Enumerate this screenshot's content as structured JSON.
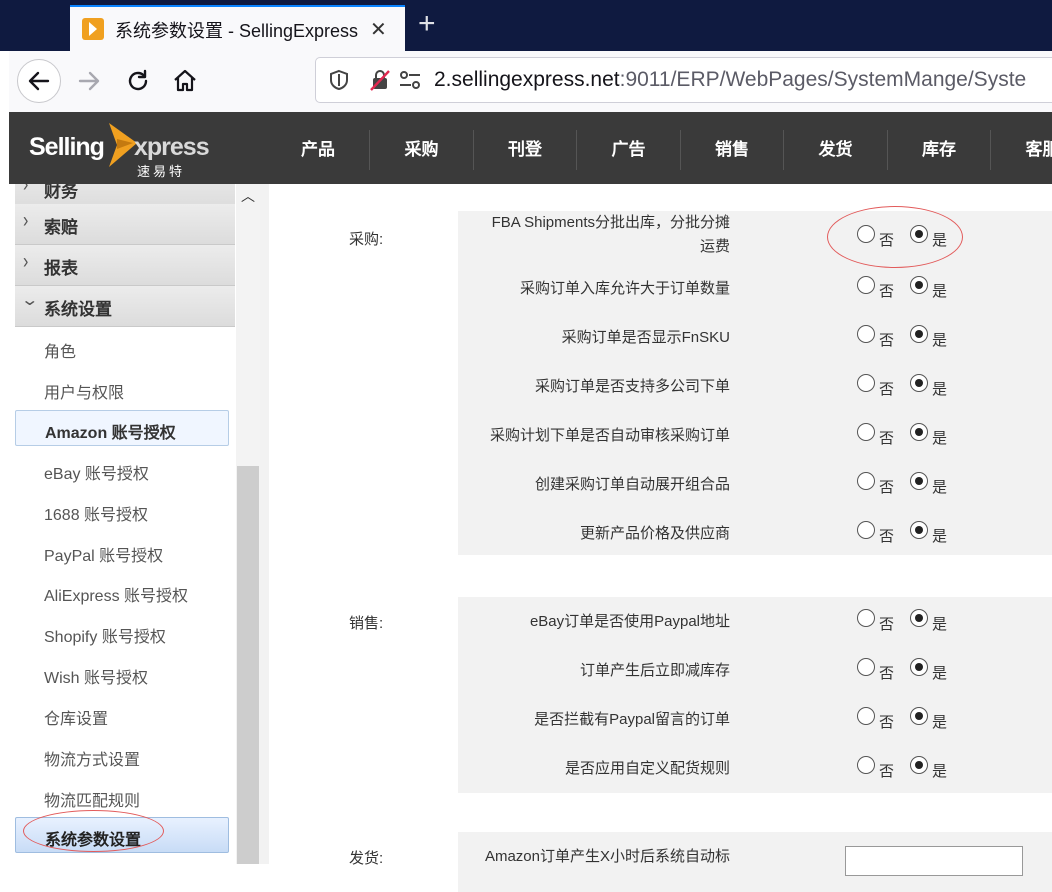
{
  "browser": {
    "tab_title": "系统参数设置 - SellingExpress",
    "close_glyph": "✕",
    "new_tab_glyph": "+",
    "url_host": "2.sellingexpress.net",
    "url_rest": ":9011/ERP/WebPages/SystemMange/Syste"
  },
  "app": {
    "logo_word1": "Selling",
    "logo_word2": "xpress",
    "logo_sub": "速易特",
    "menu": [
      "产品",
      "采购",
      "刊登",
      "广告",
      "销售",
      "发货",
      "库存",
      "客服"
    ]
  },
  "sidebar": {
    "groups": [
      {
        "label": "财务",
        "chevron": "›"
      },
      {
        "label": "索赔",
        "chevron": "›"
      },
      {
        "label": "报表",
        "chevron": "›"
      },
      {
        "label": "系统设置",
        "chevron": "⌄"
      }
    ],
    "items": [
      "角色",
      "用户与权限",
      "Amazon 账号授权",
      "eBay 账号授权",
      "1688 账号授权",
      "PayPal 账号授权",
      "AliExpress 账号授权",
      "Shopify 账号授权",
      "Wish 账号授权",
      "仓库设置",
      "物流方式设置",
      "物流匹配规则",
      "系统参数设置"
    ],
    "active_item": "Amazon 账号授权",
    "current_item": "系统参数设置"
  },
  "radio_labels": {
    "no": "否",
    "yes": "是"
  },
  "sections": [
    {
      "label": "采购:",
      "rows": [
        {
          "line1": "FBA Shipments分批出库，分批分摊",
          "line2": "运费",
          "value": "是"
        },
        {
          "line1": "采购订单入库允许大于订单数量",
          "value": "是"
        },
        {
          "line1": "采购订单是否显示FnSKU",
          "value": "是"
        },
        {
          "line1": "采购订单是否支持多公司下单",
          "value": "是"
        },
        {
          "line1": "采购计划下单是否自动审核采购订单",
          "value": "是"
        },
        {
          "line1": "创建采购订单自动展开组合品",
          "value": "是"
        },
        {
          "line1": "更新产品价格及供应商",
          "value": "是"
        }
      ]
    },
    {
      "label": "销售:",
      "rows": [
        {
          "line1": "eBay订单是否使用Paypal地址",
          "value": "是"
        },
        {
          "line1": "订单产生后立即减库存",
          "value": "是"
        },
        {
          "line1": "是否拦截有Paypal留言的订单",
          "value": "是"
        },
        {
          "line1": "是否应用自定义配货规则",
          "value": "是"
        }
      ]
    },
    {
      "label": "发货:",
      "rows": [
        {
          "line1": "Amazon订单产生X小时后系统自动标"
        }
      ]
    }
  ]
}
